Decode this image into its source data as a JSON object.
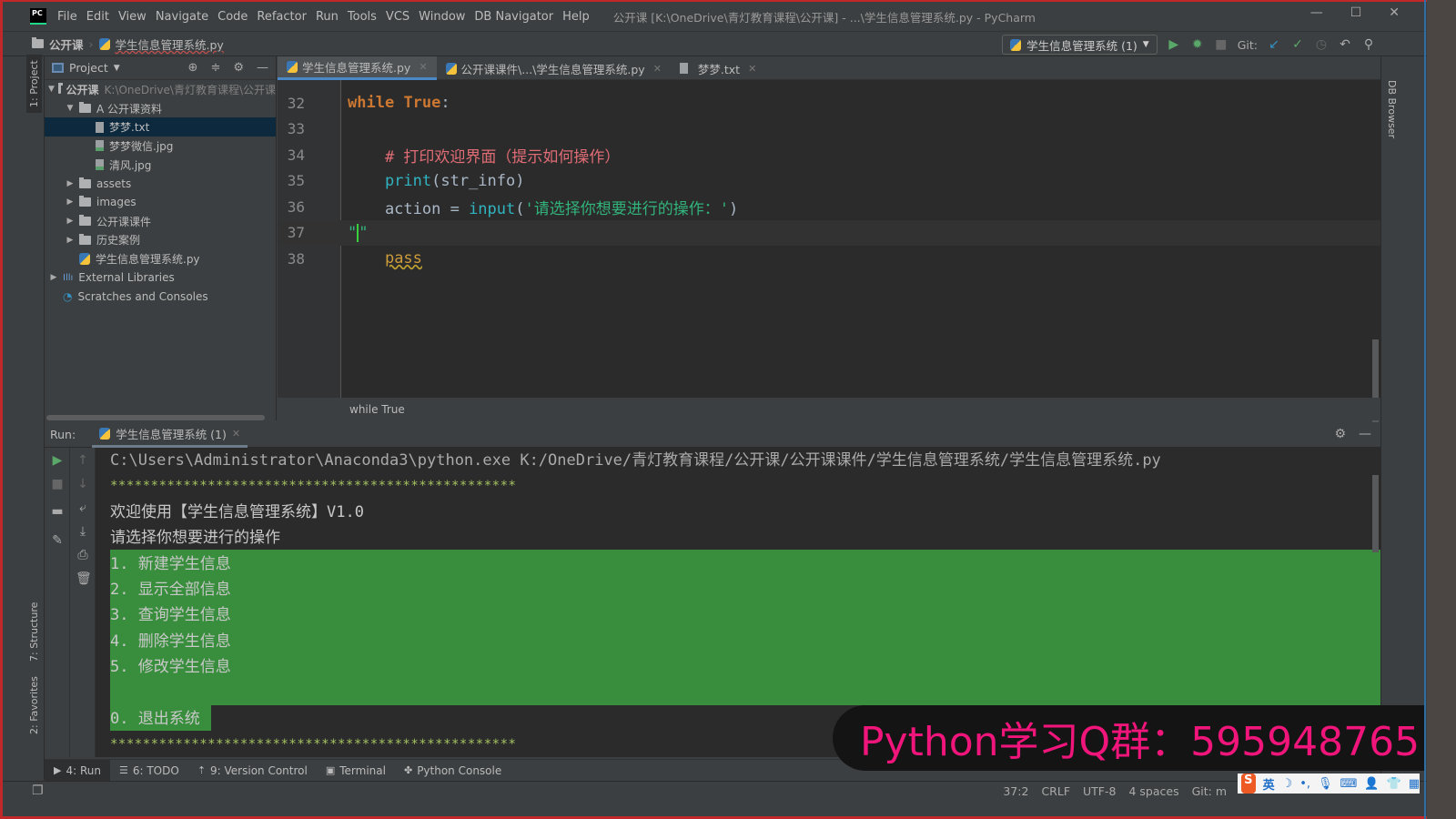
{
  "window": {
    "title": "公开课 [K:\\OneDrive\\青灯教育课程\\公开课] - ...\\学生信息管理系统.py - PyCharm",
    "app_logo": "PC",
    "controls": {
      "minimize": "—",
      "maximize": "☐",
      "close": "✕"
    }
  },
  "menu": [
    "File",
    "Edit",
    "View",
    "Navigate",
    "Code",
    "Refactor",
    "Run",
    "Tools",
    "VCS",
    "Window",
    "DB Navigator",
    "Help"
  ],
  "navbar": {
    "crumbs": [
      "公开课",
      "学生信息管理系统.py"
    ],
    "run_config": "学生信息管理系统 (1)",
    "git_label": "Git:"
  },
  "left_strip": {
    "project_tab": "1: Project",
    "structure_tab": "7: Structure",
    "favorites_tab": "2: Favorites"
  },
  "right_strip": {
    "db_browser": "DB Browser"
  },
  "project": {
    "title": "Project",
    "tree": [
      {
        "label": "公开课",
        "hint": "K:\\OneDrive\\青灯教育课程\\公开课",
        "type": "folder",
        "level": 0,
        "expanded": true
      },
      {
        "label": "A 公开课资料",
        "type": "folder",
        "level": 1,
        "expanded": true
      },
      {
        "label": "梦梦.txt",
        "type": "text",
        "level": 2,
        "selected": true
      },
      {
        "label": "梦梦微信.jpg",
        "type": "image",
        "level": 2
      },
      {
        "label": "清风.jpg",
        "type": "image",
        "level": 2
      },
      {
        "label": "assets",
        "type": "folder",
        "level": 1,
        "expanded": false
      },
      {
        "label": "images",
        "type": "folder",
        "level": 1,
        "expanded": false
      },
      {
        "label": "公开课课件",
        "type": "folder",
        "level": 1,
        "expanded": false
      },
      {
        "label": "历史案例",
        "type": "folder",
        "level": 1,
        "expanded": false
      },
      {
        "label": "学生信息管理系统.py",
        "type": "python",
        "level": 1
      },
      {
        "label": "External Libraries",
        "type": "library",
        "level": 0,
        "expanded": false
      },
      {
        "label": "Scratches and Consoles",
        "type": "scratch",
        "level": 0
      }
    ]
  },
  "editor": {
    "tabs": [
      {
        "label": "学生信息管理系统.py",
        "active": true
      },
      {
        "label": "公开课课件\\...\\学生信息管理系统.py",
        "active": false
      },
      {
        "label": "梦梦.txt",
        "active": false
      }
    ],
    "lines": [
      {
        "num": "32",
        "tokens": [
          [
            "kw",
            "while"
          ],
          [
            "id",
            " "
          ],
          [
            "kwtrue",
            "True"
          ],
          [
            "id",
            ":"
          ]
        ]
      },
      {
        "num": "33",
        "tokens": []
      },
      {
        "num": "34",
        "tokens": [
          [
            "cmt",
            "    # 打印欢迎界面（提示如何操作）"
          ]
        ]
      },
      {
        "num": "35",
        "tokens": [
          [
            "fn",
            "    print"
          ],
          [
            "id",
            "(str_info)"
          ]
        ]
      },
      {
        "num": "36",
        "tokens": [
          [
            "id",
            "    action = "
          ],
          [
            "fn",
            "input"
          ],
          [
            "id",
            "("
          ],
          [
            "str",
            "'请选择你想要进行的操作：'"
          ],
          [
            "id",
            ")"
          ]
        ]
      },
      {
        "num": "37",
        "tokens": [
          [
            "str",
            "\"\""
          ]
        ],
        "current": true
      },
      {
        "num": "38",
        "tokens": [
          [
            "id",
            "    "
          ],
          [
            "warn",
            "pass"
          ]
        ]
      }
    ],
    "breadcrumb": "while True",
    "caret_position": "37:2"
  },
  "run": {
    "label": "Run:",
    "tab": "学生信息管理系统 (1)",
    "output": [
      "C:\\Users\\Administrator\\Anaconda3\\python.exe K:/OneDrive/青灯教育课程/公开课/公开课课件/学生信息管理系统/学生信息管理系统.py",
      "**************************************************",
      "欢迎使用【学生信息管理系统】V1.0",
      "请选择你想要进行的操作",
      "1. 新建学生信息",
      "2. 显示全部信息",
      "3. 查询学生信息",
      "4. 删除学生信息",
      "5. 修改学生信息",
      "",
      "0. 退出系统",
      "**************************************************"
    ]
  },
  "toolwindows": [
    {
      "label": "4: Run",
      "icon": "run-icon",
      "active": true
    },
    {
      "label": "6: TODO",
      "icon": "todo-icon"
    },
    {
      "label": "9: Version Control",
      "icon": "vcs-icon"
    },
    {
      "label": "Terminal",
      "icon": "terminal-icon"
    },
    {
      "label": "Python Console",
      "icon": "python-icon"
    }
  ],
  "status": {
    "position": "37:2",
    "line_sep": "CRLF",
    "encoding": "UTF-8",
    "indent": "4 spaces",
    "git": "Git: m"
  },
  "overlay": {
    "banner": "Python学习Q群：595948765",
    "ime_lang": "英"
  },
  "colors": {
    "selection_green": "#388e3c",
    "banner_text": "#f0157a",
    "accent_blue": "#4a88c7"
  }
}
